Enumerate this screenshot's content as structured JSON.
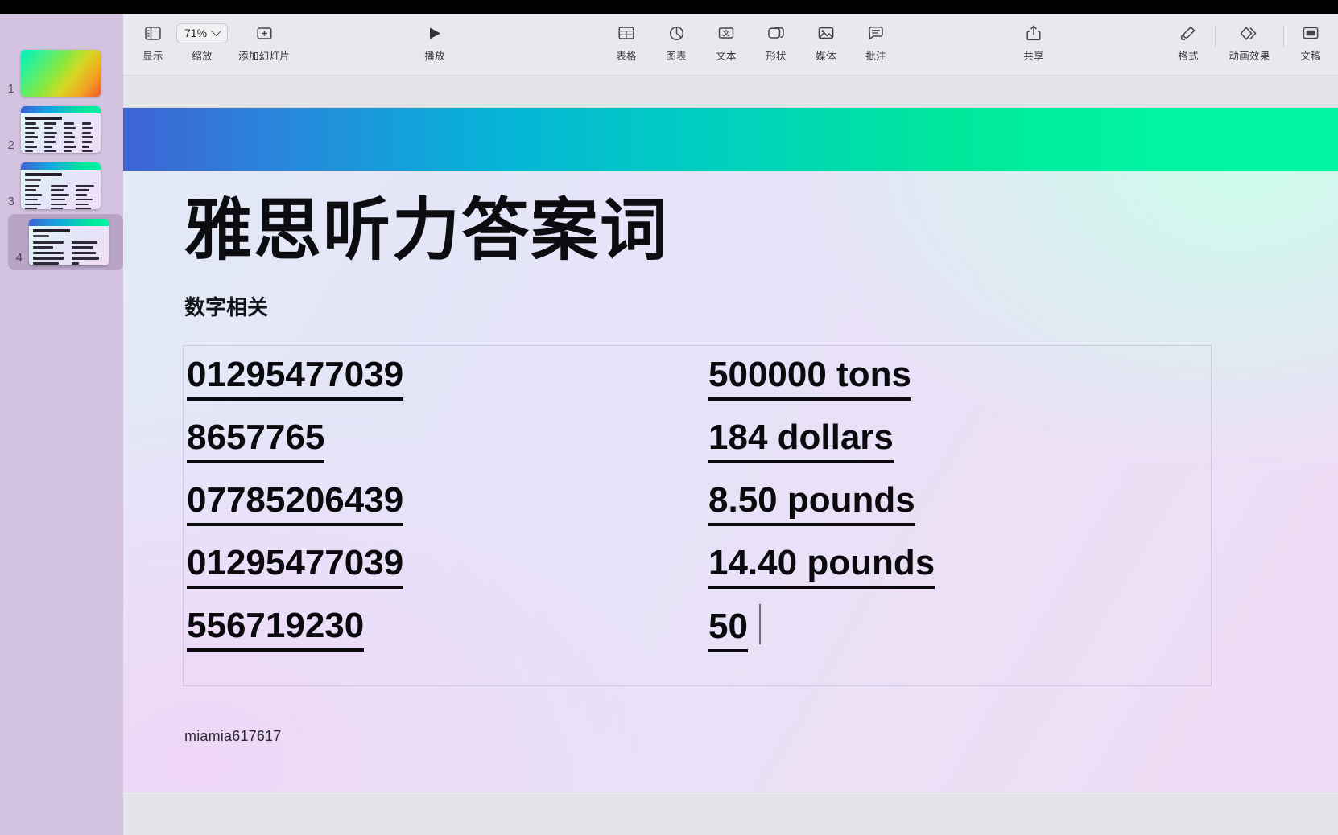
{
  "app": {
    "name": "Keynote",
    "zoom_level": "71%"
  },
  "toolbar": {
    "left_group": [
      {
        "id": "view",
        "label": "显示",
        "icon": "sidebar-panel-icon"
      },
      {
        "id": "zoom",
        "label": "缩放",
        "icon": "chevron-down-icon",
        "value": "71%"
      },
      {
        "id": "add-slide",
        "label": "添加幻灯片",
        "icon": "plus-square-icon"
      }
    ],
    "play": {
      "label": "播放",
      "icon": "play-triangle-icon"
    },
    "insert_group": [
      {
        "id": "table",
        "label": "表格",
        "icon": "table-grid-icon"
      },
      {
        "id": "chart",
        "label": "图表",
        "icon": "pie-chart-icon"
      },
      {
        "id": "text",
        "label": "文本",
        "icon": "text-box-icon"
      },
      {
        "id": "shape",
        "label": "形状",
        "icon": "shapes-icon"
      },
      {
        "id": "media",
        "label": "媒体",
        "icon": "photo-icon"
      },
      {
        "id": "comment",
        "label": "批注",
        "icon": "comment-bubble-icon"
      }
    ],
    "share": {
      "label": "共享",
      "icon": "share-upload-icon"
    },
    "right_group": [
      {
        "id": "format",
        "label": "格式",
        "icon": "paintbrush-icon"
      },
      {
        "id": "animate",
        "label": "动画效果",
        "icon": "diamonds-icon"
      },
      {
        "id": "document",
        "label": "文稿",
        "icon": "document-window-icon"
      }
    ]
  },
  "sidebar": {
    "slides": [
      {
        "number": "1",
        "type": "cover",
        "selected": false
      },
      {
        "number": "2",
        "type": "content",
        "selected": false
      },
      {
        "number": "3",
        "type": "content",
        "selected": false
      },
      {
        "number": "4",
        "type": "content",
        "selected": true
      }
    ]
  },
  "slide": {
    "title": "雅思听力答案词",
    "subtitle": "数字相关",
    "footer": "miamia617617",
    "colors": {
      "bar_start": "#3f63d4",
      "bar_mid": "#00cfc0",
      "bar_end": "#00f5a3",
      "bg_mint": "#ccfdeb",
      "bg_pink": "#f0d6f7",
      "text": "#0b0b0f"
    },
    "columns": [
      {
        "id": "left-column",
        "entries": [
          "01295477039",
          "8657765",
          "07785206439",
          "01295477039",
          "556719230"
        ]
      },
      {
        "id": "right-column",
        "entries": [
          "500000 tons",
          "184 dollars",
          "8.50 pounds",
          "14.40 pounds",
          "50"
        ]
      }
    ]
  }
}
